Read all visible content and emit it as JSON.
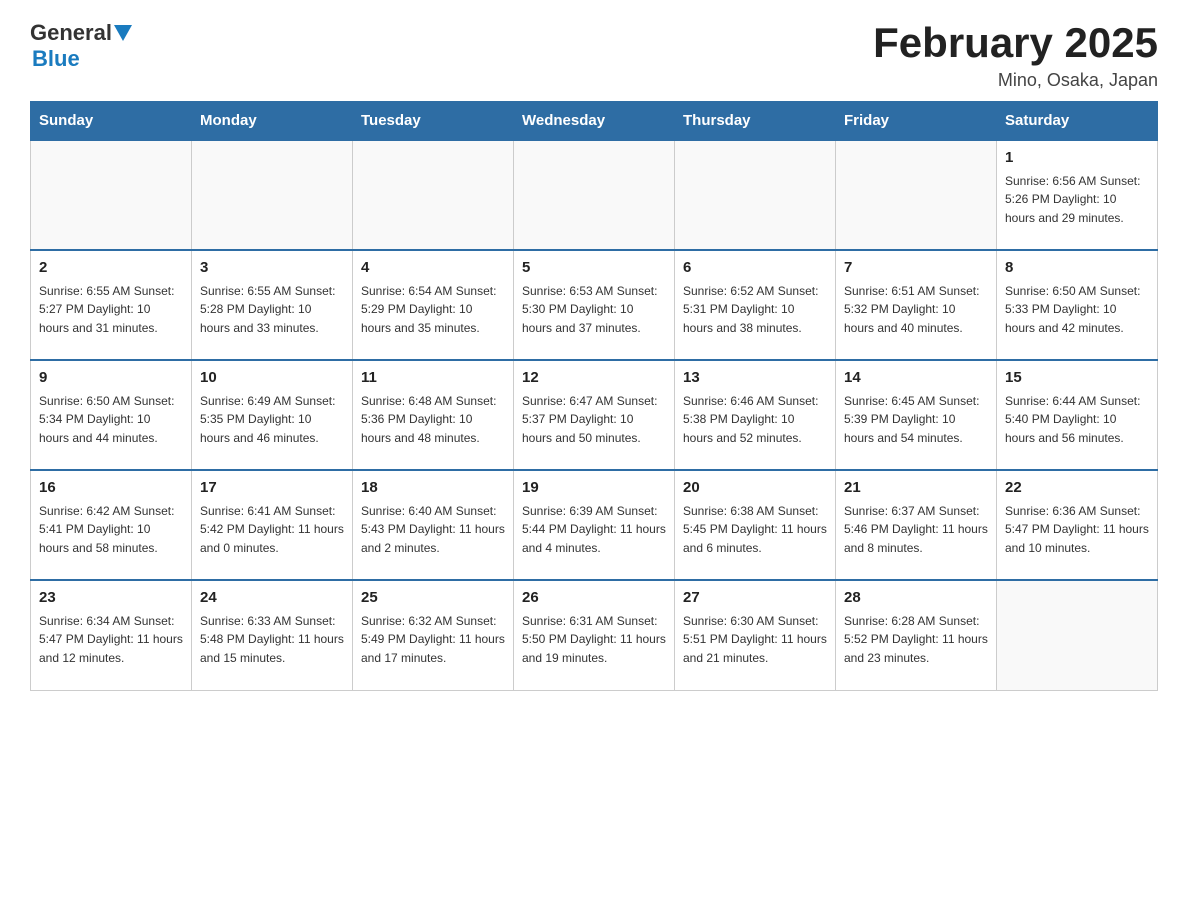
{
  "header": {
    "logo_general": "General",
    "logo_blue": "Blue",
    "month_title": "February 2025",
    "location": "Mino, Osaka, Japan"
  },
  "days_of_week": [
    "Sunday",
    "Monday",
    "Tuesday",
    "Wednesday",
    "Thursday",
    "Friday",
    "Saturday"
  ],
  "weeks": [
    [
      {
        "day": "",
        "info": ""
      },
      {
        "day": "",
        "info": ""
      },
      {
        "day": "",
        "info": ""
      },
      {
        "day": "",
        "info": ""
      },
      {
        "day": "",
        "info": ""
      },
      {
        "day": "",
        "info": ""
      },
      {
        "day": "1",
        "info": "Sunrise: 6:56 AM\nSunset: 5:26 PM\nDaylight: 10 hours and 29 minutes."
      }
    ],
    [
      {
        "day": "2",
        "info": "Sunrise: 6:55 AM\nSunset: 5:27 PM\nDaylight: 10 hours and 31 minutes."
      },
      {
        "day": "3",
        "info": "Sunrise: 6:55 AM\nSunset: 5:28 PM\nDaylight: 10 hours and 33 minutes."
      },
      {
        "day": "4",
        "info": "Sunrise: 6:54 AM\nSunset: 5:29 PM\nDaylight: 10 hours and 35 minutes."
      },
      {
        "day": "5",
        "info": "Sunrise: 6:53 AM\nSunset: 5:30 PM\nDaylight: 10 hours and 37 minutes."
      },
      {
        "day": "6",
        "info": "Sunrise: 6:52 AM\nSunset: 5:31 PM\nDaylight: 10 hours and 38 minutes."
      },
      {
        "day": "7",
        "info": "Sunrise: 6:51 AM\nSunset: 5:32 PM\nDaylight: 10 hours and 40 minutes."
      },
      {
        "day": "8",
        "info": "Sunrise: 6:50 AM\nSunset: 5:33 PM\nDaylight: 10 hours and 42 minutes."
      }
    ],
    [
      {
        "day": "9",
        "info": "Sunrise: 6:50 AM\nSunset: 5:34 PM\nDaylight: 10 hours and 44 minutes."
      },
      {
        "day": "10",
        "info": "Sunrise: 6:49 AM\nSunset: 5:35 PM\nDaylight: 10 hours and 46 minutes."
      },
      {
        "day": "11",
        "info": "Sunrise: 6:48 AM\nSunset: 5:36 PM\nDaylight: 10 hours and 48 minutes."
      },
      {
        "day": "12",
        "info": "Sunrise: 6:47 AM\nSunset: 5:37 PM\nDaylight: 10 hours and 50 minutes."
      },
      {
        "day": "13",
        "info": "Sunrise: 6:46 AM\nSunset: 5:38 PM\nDaylight: 10 hours and 52 minutes."
      },
      {
        "day": "14",
        "info": "Sunrise: 6:45 AM\nSunset: 5:39 PM\nDaylight: 10 hours and 54 minutes."
      },
      {
        "day": "15",
        "info": "Sunrise: 6:44 AM\nSunset: 5:40 PM\nDaylight: 10 hours and 56 minutes."
      }
    ],
    [
      {
        "day": "16",
        "info": "Sunrise: 6:42 AM\nSunset: 5:41 PM\nDaylight: 10 hours and 58 minutes."
      },
      {
        "day": "17",
        "info": "Sunrise: 6:41 AM\nSunset: 5:42 PM\nDaylight: 11 hours and 0 minutes."
      },
      {
        "day": "18",
        "info": "Sunrise: 6:40 AM\nSunset: 5:43 PM\nDaylight: 11 hours and 2 minutes."
      },
      {
        "day": "19",
        "info": "Sunrise: 6:39 AM\nSunset: 5:44 PM\nDaylight: 11 hours and 4 minutes."
      },
      {
        "day": "20",
        "info": "Sunrise: 6:38 AM\nSunset: 5:45 PM\nDaylight: 11 hours and 6 minutes."
      },
      {
        "day": "21",
        "info": "Sunrise: 6:37 AM\nSunset: 5:46 PM\nDaylight: 11 hours and 8 minutes."
      },
      {
        "day": "22",
        "info": "Sunrise: 6:36 AM\nSunset: 5:47 PM\nDaylight: 11 hours and 10 minutes."
      }
    ],
    [
      {
        "day": "23",
        "info": "Sunrise: 6:34 AM\nSunset: 5:47 PM\nDaylight: 11 hours and 12 minutes."
      },
      {
        "day": "24",
        "info": "Sunrise: 6:33 AM\nSunset: 5:48 PM\nDaylight: 11 hours and 15 minutes."
      },
      {
        "day": "25",
        "info": "Sunrise: 6:32 AM\nSunset: 5:49 PM\nDaylight: 11 hours and 17 minutes."
      },
      {
        "day": "26",
        "info": "Sunrise: 6:31 AM\nSunset: 5:50 PM\nDaylight: 11 hours and 19 minutes."
      },
      {
        "day": "27",
        "info": "Sunrise: 6:30 AM\nSunset: 5:51 PM\nDaylight: 11 hours and 21 minutes."
      },
      {
        "day": "28",
        "info": "Sunrise: 6:28 AM\nSunset: 5:52 PM\nDaylight: 11 hours and 23 minutes."
      },
      {
        "day": "",
        "info": ""
      }
    ]
  ]
}
